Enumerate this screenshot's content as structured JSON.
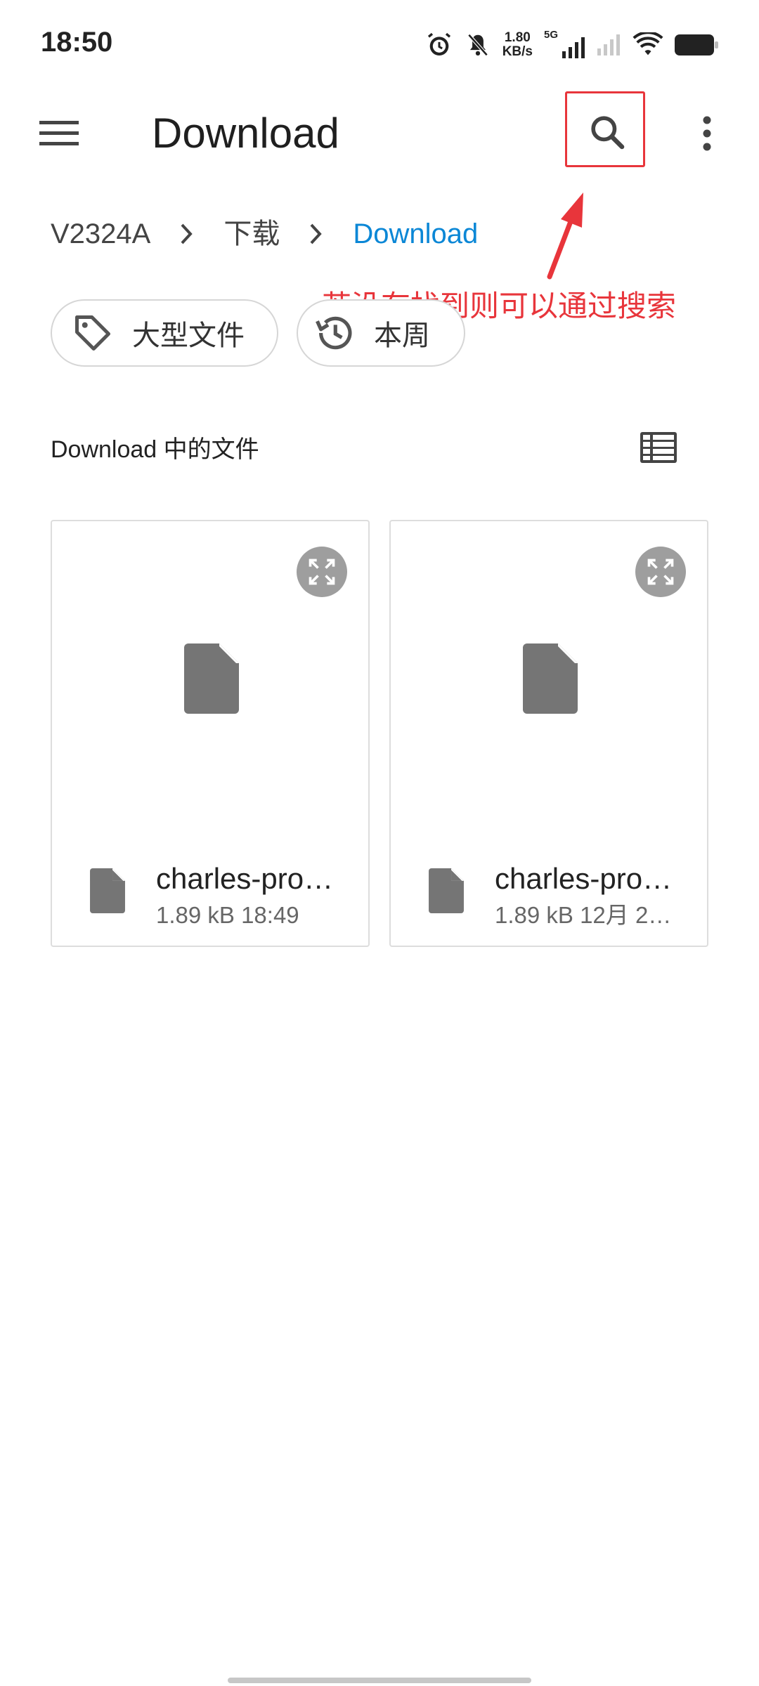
{
  "status_bar": {
    "time": "18:50",
    "net_speed_value": "1.80",
    "net_speed_unit": "KB/s",
    "network_type": "5G",
    "icons": [
      "alarm-icon",
      "mute-bell-icon",
      "signal-icon",
      "wifi-icon",
      "battery-icon"
    ]
  },
  "app_bar": {
    "title": "Download",
    "menu_icon": "hamburger-menu-icon",
    "search_icon": "search-icon",
    "more_icon": "more-vertical-icon"
  },
  "breadcrumb": [
    {
      "label": "V2324A"
    },
    {
      "label": "下载"
    },
    {
      "label": "Download"
    }
  ],
  "annotation": {
    "text": "若没有找到则可以通过搜索",
    "color": "#e8353b"
  },
  "chips": [
    {
      "label": "大型文件",
      "icon": "tag-icon"
    },
    {
      "label": "本周",
      "icon": "history-icon"
    }
  ],
  "section": {
    "title": "Download 中的文件",
    "view_icon": "list-view-icon"
  },
  "files": [
    {
      "name": "charles-pro…",
      "meta": "1.89 kB 18:49"
    },
    {
      "name": "charles-pro…",
      "meta": "1.89 kB 12月 2…"
    }
  ],
  "colors": {
    "accent": "#0b87d6",
    "annotation": "#e8353b",
    "icon_gray": "#757575"
  }
}
